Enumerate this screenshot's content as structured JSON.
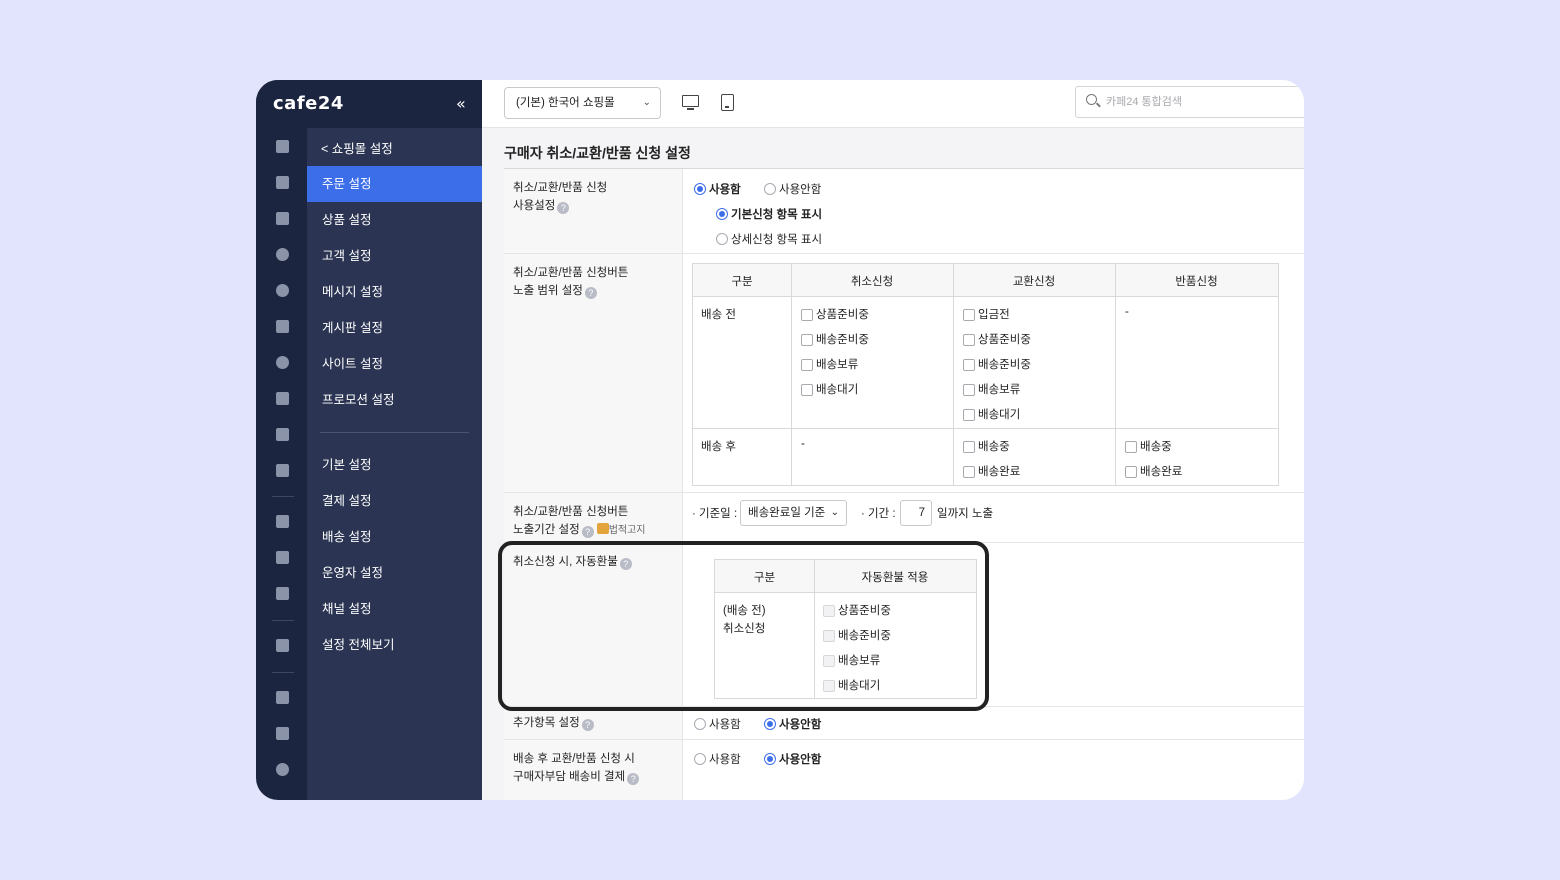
{
  "brand": {
    "logo": "cafe24",
    "collapse": "«"
  },
  "rail_icons": [
    "home-icon",
    "cart-icon",
    "shirt-icon",
    "person-icon",
    "chat-icon",
    "board-icon",
    "palette-icon",
    "coupon-icon",
    "chart-icon",
    "mobile-icon",
    "briefcase-icon",
    "megaphone-icon",
    "store-icon",
    "truck-icon",
    "apps-icon",
    "folder-icon",
    "link-icon"
  ],
  "sidebar": {
    "back": "< 쇼핑몰 설정",
    "items": [
      "주문 설정",
      "상품 설정",
      "고객 설정",
      "메시지 설정",
      "게시판 설정",
      "사이트 설정",
      "프로모션 설정"
    ],
    "items2": [
      "기본 설정",
      "결제 설정",
      "배송 설정",
      "운영자 설정",
      "채널 설정",
      "설정 전체보기"
    ]
  },
  "topbar": {
    "shop_select": "(기본) 한국어 쇼핑몰",
    "search_placeholder": "카페24 통합검색"
  },
  "page": {
    "title": "구매자 취소/교환/반품 신청 설정",
    "use_setting": {
      "label1": "취소/교환/반품 신청",
      "label2": "사용설정",
      "use": "사용함",
      "not_use": "사용안함",
      "basic": "기본신청 항목 표시",
      "detail": "상세신청 항목 표시"
    },
    "button_range": {
      "label1": "취소/교환/반품 신청버튼",
      "label2": "노출 범위 설정",
      "headers": [
        "구분",
        "취소신청",
        "교환신청",
        "반품신청"
      ],
      "before": "배송 전",
      "after": "배송 후",
      "cancel_before": [
        "상품준비중",
        "배송준비중",
        "배송보류",
        "배송대기"
      ],
      "exchange_before": [
        "입금전",
        "상품준비중",
        "배송준비중",
        "배송보류",
        "배송대기"
      ],
      "return_before": "-",
      "cancel_after": "-",
      "exchange_after": [
        "배송중",
        "배송완료"
      ],
      "return_after": [
        "배송중",
        "배송완료"
      ]
    },
    "button_period": {
      "label1": "취소/교환/반품 신청버튼",
      "label2": "노출기간 설정",
      "law": "법적고지",
      "base_label": "· 기준일 :",
      "base_value": "배송완료일 기준",
      "period_label": "· 기간 :",
      "period_value": "7",
      "suffix": "일까지 노출"
    },
    "auto_refund": {
      "label": "취소신청 시, 자동환불",
      "headers": [
        "구분",
        "자동환불 적용"
      ],
      "row_label1": "(배송 전)",
      "row_label2": "취소신청",
      "items": [
        "상품준비중",
        "배송준비중",
        "배송보류",
        "배송대기"
      ]
    },
    "extra": {
      "label": "추가항목 설정",
      "use": "사용함",
      "not_use": "사용안함"
    },
    "shipping_fee": {
      "label1": "배송 후 교환/반품 신청 시",
      "label2": "구매자부담 배송비 결제",
      "use": "사용함",
      "not_use": "사용안함"
    }
  },
  "colors": {
    "accent": "#3d6ee9",
    "sidebar": "#2b3553",
    "rail": "#1b2540",
    "background": "#e2e3fd"
  }
}
